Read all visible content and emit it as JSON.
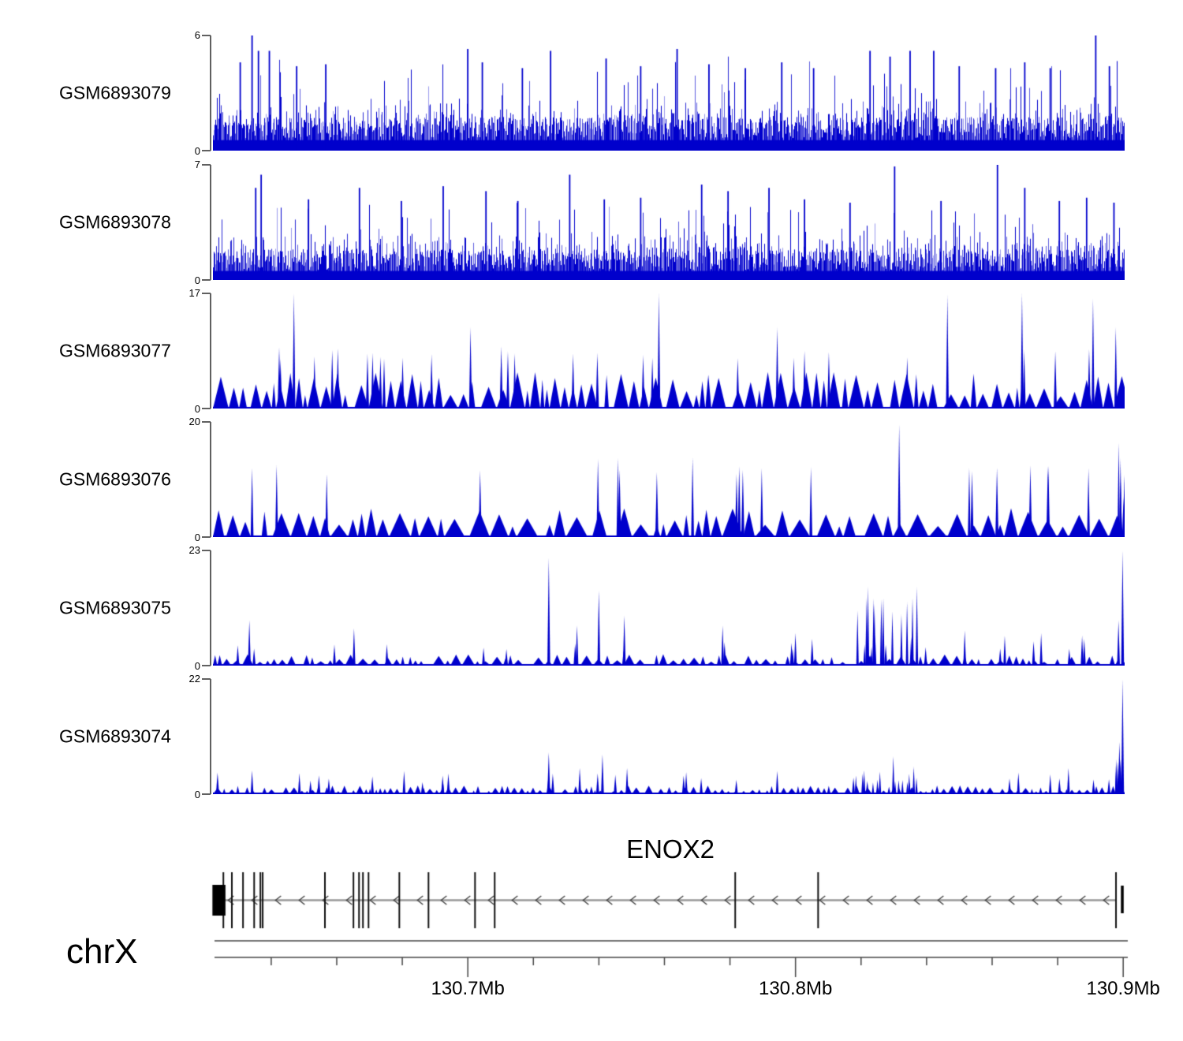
{
  "figure": {
    "background": "#ffffff"
  },
  "chart_data": {
    "type": "area",
    "description": "Genome-browser read coverage tracks (6 GEO samples) over the ENOX2 locus on chrX, 130.62-130.90 Mb",
    "signal_color": "#0000CC",
    "axis": {
      "chrom_label": "chrX",
      "unit": "Mb",
      "start_mb": 130.6227,
      "end_mb": 130.9014,
      "major_ticks": [
        {
          "mb": 130.7,
          "label": "130.7Mb"
        },
        {
          "mb": 130.8,
          "label": "130.8Mb"
        },
        {
          "mb": 130.9,
          "label": "130.9Mb"
        }
      ],
      "minor_tick_start_mb": 130.64,
      "minor_tick_step_mb": 0.02
    },
    "gene": {
      "title": "ENOX2",
      "strand": "-",
      "transcript_start_mb": 130.6223,
      "transcript_end_mb": 130.8978,
      "utr_blocks_mb": [
        [
          130.6223,
          130.6258
        ],
        [
          130.8993,
          130.9
        ]
      ],
      "exons_mb": [
        130.6254,
        130.628,
        130.6314,
        130.6348,
        130.6367,
        130.6374,
        130.6564,
        130.6651,
        130.6668,
        130.668,
        130.6697,
        130.6791,
        130.688,
        130.7022,
        130.7082,
        130.7816,
        130.8069,
        130.8978
      ]
    },
    "tracks": [
      {
        "label": "GSM6893079",
        "ymin_label": "0",
        "ymax_label": "6",
        "ymax": 6,
        "style": "bars",
        "seed": 101,
        "gen": {
          "solid": 0.55,
          "lo": 0.65,
          "hi": 1.75,
          "extra_p": 0.38,
          "extra": 1.15,
          "spike_p": 0.05,
          "spike_lo": 0.8,
          "spike_hi": 2.9,
          "clamp": 5.0
        },
        "spikes": [
          {
            "f": 0.03,
            "v": 4.6
          },
          {
            "f": 0.043,
            "v": 6.0
          },
          {
            "f": 0.05,
            "v": 5.2
          },
          {
            "f": 0.062,
            "v": 5.2
          },
          {
            "f": 0.092,
            "v": 4.4
          },
          {
            "f": 0.124,
            "v": 4.5
          },
          {
            "f": 0.28,
            "v": 5.3
          },
          {
            "f": 0.296,
            "v": 4.6
          },
          {
            "f": 0.34,
            "v": 4.3
          },
          {
            "f": 0.371,
            "v": 5.2
          },
          {
            "f": 0.432,
            "v": 4.8
          },
          {
            "f": 0.47,
            "v": 4.4
          },
          {
            "f": 0.51,
            "v": 5.3
          },
          {
            "f": 0.545,
            "v": 4.5
          },
          {
            "f": 0.585,
            "v": 4.3
          },
          {
            "f": 0.625,
            "v": 4.6
          },
          {
            "f": 0.66,
            "v": 4.3
          },
          {
            "f": 0.722,
            "v": 5.2
          },
          {
            "f": 0.744,
            "v": 4.9
          },
          {
            "f": 0.766,
            "v": 5.2
          },
          {
            "f": 0.792,
            "v": 5.2
          },
          {
            "f": 0.82,
            "v": 4.4
          },
          {
            "f": 0.86,
            "v": 4.3
          },
          {
            "f": 0.892,
            "v": 4.6
          },
          {
            "f": 0.92,
            "v": 4.3
          },
          {
            "f": 0.97,
            "v": 6.0
          },
          {
            "f": 0.985,
            "v": 4.4
          }
        ],
        "clusters": []
      },
      {
        "label": "GSM6893078",
        "ymin_label": "0",
        "ymax_label": "7",
        "ymax": 7,
        "style": "bars",
        "seed": 202,
        "gen": {
          "solid": 0.55,
          "lo": 0.6,
          "hi": 1.9,
          "extra_p": 0.4,
          "extra": 1.3,
          "spike_p": 0.055,
          "spike_lo": 0.9,
          "spike_hi": 3.0,
          "clamp": 5.1
        },
        "spikes": [
          {
            "f": 0.047,
            "v": 5.6
          },
          {
            "f": 0.053,
            "v": 6.4
          },
          {
            "f": 0.105,
            "v": 4.9
          },
          {
            "f": 0.161,
            "v": 5.6
          },
          {
            "f": 0.207,
            "v": 4.8
          },
          {
            "f": 0.253,
            "v": 5.7
          },
          {
            "f": 0.3,
            "v": 5.4
          },
          {
            "f": 0.335,
            "v": 4.8
          },
          {
            "f": 0.392,
            "v": 6.4
          },
          {
            "f": 0.43,
            "v": 4.9
          },
          {
            "f": 0.47,
            "v": 5.0
          },
          {
            "f": 0.537,
            "v": 5.8
          },
          {
            "f": 0.566,
            "v": 5.4
          },
          {
            "f": 0.611,
            "v": 5.6
          },
          {
            "f": 0.65,
            "v": 4.9
          },
          {
            "f": 0.7,
            "v": 4.7
          },
          {
            "f": 0.749,
            "v": 6.9
          },
          {
            "f": 0.8,
            "v": 4.8
          },
          {
            "f": 0.862,
            "v": 7.0
          },
          {
            "f": 0.892,
            "v": 5.6
          },
          {
            "f": 0.93,
            "v": 4.8
          },
          {
            "f": 0.96,
            "v": 5.0
          },
          {
            "f": 0.99,
            "v": 4.7
          }
        ],
        "clusters": []
      },
      {
        "label": "GSM6893077",
        "ymin_label": "0",
        "ymax_label": "17",
        "ymax": 17,
        "style": "peaks",
        "seed": 303,
        "gen": {
          "wlo": 5,
          "whi": 21,
          "hlo": 1.8,
          "hhi": 5.4,
          "gap_p": 0.22,
          "gap": 9,
          "med_n": 26,
          "med_lo": 7.2,
          "med_hi": 9.2
        },
        "spikes": [
          {
            "f": 0.089,
            "v": 17.0
          },
          {
            "f": 0.283,
            "v": 12.0
          },
          {
            "f": 0.49,
            "v": 17.2
          },
          {
            "f": 0.62,
            "v": 12.0
          },
          {
            "f": 0.807,
            "v": 16.8
          },
          {
            "f": 0.889,
            "v": 17.0
          },
          {
            "f": 0.967,
            "v": 16.2
          },
          {
            "f": 0.992,
            "v": 12.0
          }
        ],
        "clusters": []
      },
      {
        "label": "GSM6893076",
        "ymin_label": "0",
        "ymax_label": "20",
        "ymax": 20,
        "style": "peaks",
        "seed": 404,
        "gen": {
          "wlo": 7,
          "whi": 28,
          "hlo": 1.8,
          "hhi": 5.0,
          "gap_p": 0.3,
          "gap": 14,
          "med_n": 10,
          "med_lo": 10.5,
          "med_hi": 13.0
        },
        "spikes": [
          {
            "f": 0.043,
            "v": 12.0
          },
          {
            "f": 0.07,
            "v": 12.5
          },
          {
            "f": 0.125,
            "v": 11.0
          },
          {
            "f": 0.423,
            "v": 13.6
          },
          {
            "f": 0.445,
            "v": 13.7
          },
          {
            "f": 0.527,
            "v": 13.8
          },
          {
            "f": 0.603,
            "v": 12.0
          },
          {
            "f": 0.657,
            "v": 12.2
          },
          {
            "f": 0.754,
            "v": 19.6
          },
          {
            "f": 0.831,
            "v": 12.0
          },
          {
            "f": 0.918,
            "v": 12.4
          },
          {
            "f": 0.962,
            "v": 12.0
          }
        ],
        "clusters": [
          {
            "from": 0.993,
            "to": 1.0,
            "count": 9,
            "vmin": 4,
            "vmax": 16.5
          }
        ]
      },
      {
        "label": "GSM6893075",
        "ymin_label": "0",
        "ymax_label": "23",
        "ymax": 23,
        "style": "peaks",
        "seed": 505,
        "gen": {
          "wlo": 5,
          "whi": 17,
          "hlo": 0.7,
          "hhi": 2.3,
          "gap_p": 0.3,
          "gap": 12,
          "med_n": 18,
          "med_lo": 3.0,
          "med_hi": 5.5
        },
        "spikes": [
          {
            "f": 0.04,
            "v": 9.0
          },
          {
            "f": 0.155,
            "v": 7.5
          },
          {
            "f": 0.369,
            "v": 21.5
          },
          {
            "f": 0.4,
            "v": 8.0
          },
          {
            "f": 0.424,
            "v": 15.0
          },
          {
            "f": 0.452,
            "v": 10.0
          },
          {
            "f": 0.56,
            "v": 8.0
          },
          {
            "f": 0.64,
            "v": 6.5
          },
          {
            "f": 0.826,
            "v": 7.0
          },
          {
            "f": 0.87,
            "v": 6.0
          },
          {
            "f": 0.91,
            "v": 6.5
          },
          {
            "f": 0.955,
            "v": 6.0
          },
          {
            "f": 0.995,
            "v": 9.0
          },
          {
            "f": 0.9995,
            "v": 23.0
          }
        ],
        "clusters": [
          {
            "from": 0.705,
            "to": 0.775,
            "count": 17,
            "vmin": 3,
            "vmax": 17
          }
        ]
      },
      {
        "label": "GSM6893074",
        "ymin_label": "0",
        "ymax_label": "22",
        "ymax": 22,
        "style": "peaks",
        "seed": 606,
        "gen": {
          "wlo": 4,
          "whi": 12,
          "hlo": 0.5,
          "hhi": 1.7,
          "gap_p": 0.28,
          "gap": 9,
          "med_n": 22,
          "med_lo": 2.2,
          "med_hi": 4.2
        },
        "spikes": [
          {
            "f": 0.043,
            "v": 4.5
          },
          {
            "f": 0.095,
            "v": 4.0
          },
          {
            "f": 0.21,
            "v": 4.5
          },
          {
            "f": 0.369,
            "v": 8.0
          },
          {
            "f": 0.403,
            "v": 5.0
          },
          {
            "f": 0.428,
            "v": 7.6
          },
          {
            "f": 0.455,
            "v": 5.0
          },
          {
            "f": 0.52,
            "v": 4.2
          },
          {
            "f": 0.62,
            "v": 4.5
          },
          {
            "f": 0.885,
            "v": 4.2
          },
          {
            "f": 0.92,
            "v": 3.8
          },
          {
            "f": 0.94,
            "v": 5.0
          },
          {
            "f": 0.996,
            "v": 10.0
          },
          {
            "f": 0.9995,
            "v": 22.0
          }
        ],
        "clusters": [
          {
            "from": 0.705,
            "to": 0.775,
            "count": 15,
            "vmin": 2,
            "vmax": 8
          },
          {
            "from": 0.988,
            "to": 0.999,
            "count": 7,
            "vmin": 2.5,
            "vmax": 8
          }
        ]
      }
    ]
  }
}
